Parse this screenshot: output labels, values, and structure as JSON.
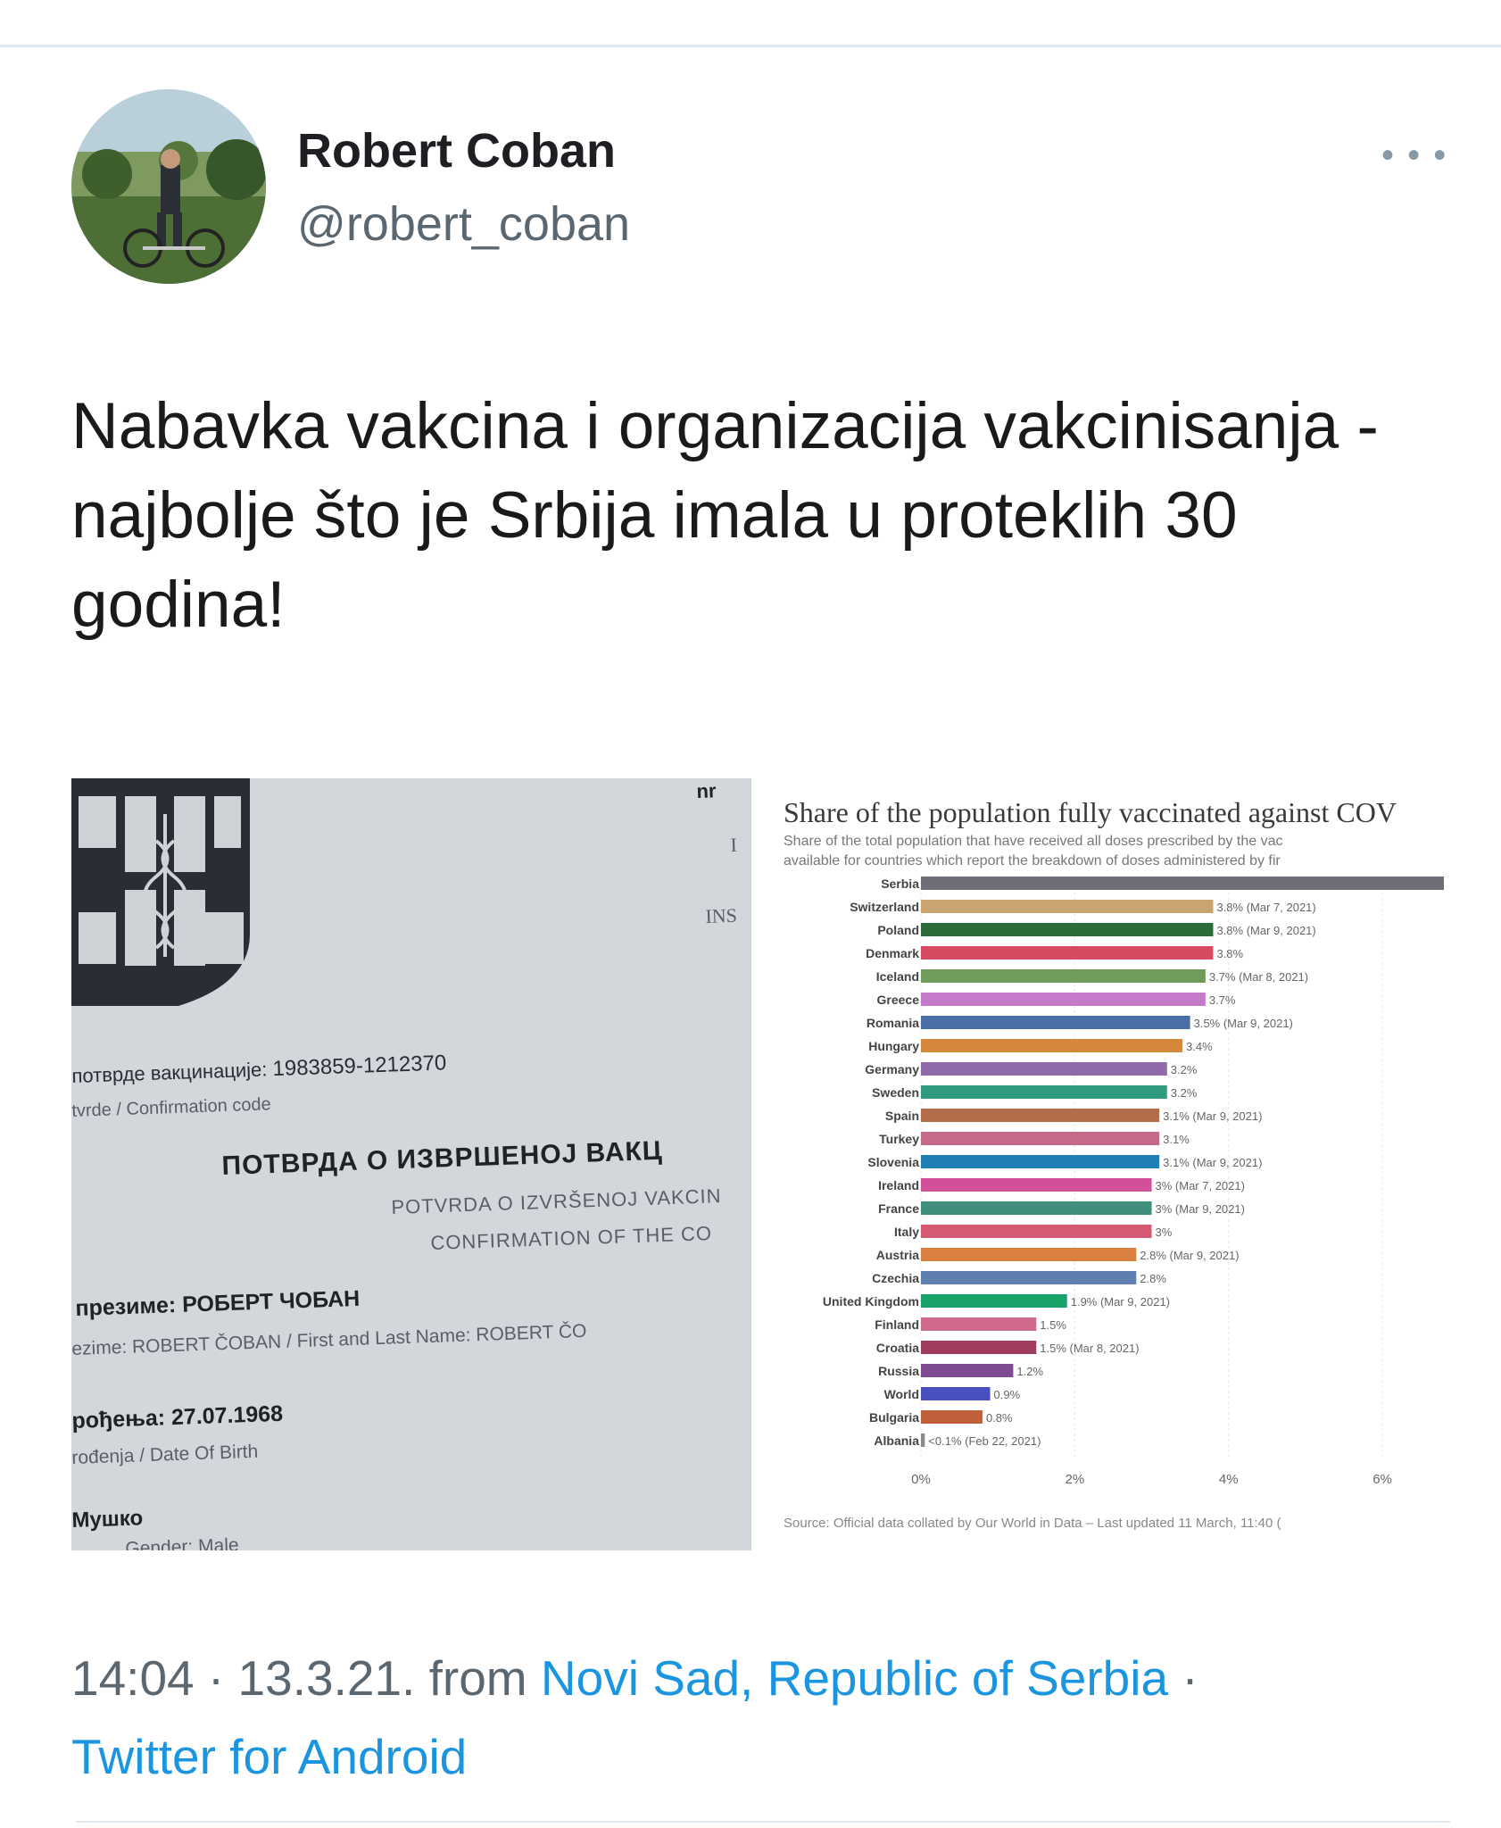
{
  "author": {
    "name": "Robert Coban",
    "handle": "@robert_coban"
  },
  "more_label": "• • •",
  "tweet_text": "Nabavka vakcina i organizacija vakcinisanja - najbolje što je Srbija imala u proteklih 30 godina!",
  "certificate": {
    "header_fragments": [
      "nr",
      "I",
      "INS"
    ],
    "code_label": "потврде вакцинације:",
    "code_value": "1983859-1212370",
    "code_label_latin": "tvrde / Confirmation code",
    "heading_cyr": "ПОТВРДА О ИЗВРШЕНОЈ ВАКЦ",
    "heading_lat": "POTVRDA O IZVRŠENOJ VAKCIN",
    "heading_en": "CONFIRMATION OF THE CO",
    "name_label": "презиме:",
    "name_value": "РОБЕРТ ЧОБАН",
    "name_latin": "ezime: ROBERT ČOBAN / First and Last Name: ROBERT ČO",
    "dob_label": "рођења:",
    "dob_value": "27.07.1968",
    "dob_latin": "rođenja / Date Of Birth",
    "gender_value": "Мушко",
    "gender_latin": "Gender: Male"
  },
  "chart_data": {
    "type": "bar",
    "orientation": "horizontal",
    "title": "Share of the population fully vaccinated against COV",
    "subtitle_lines": [
      "Share of the total population that have received all doses prescribed by the vac",
      "available for countries which report the breakdown of doses administered by fir"
    ],
    "source": "Source: Official data collated by Our World in Data – Last updated 11 March, 11:40 (",
    "categories": [
      "Serbia",
      "Switzerland",
      "Poland",
      "Denmark",
      "Iceland",
      "Greece",
      "Romania",
      "Hungary",
      "Germany",
      "Sweden",
      "Spain",
      "Turkey",
      "Slovenia",
      "Ireland",
      "France",
      "Italy",
      "Austria",
      "Czechia",
      "United Kingdom",
      "Finland",
      "Croatia",
      "Russia",
      "World",
      "Bulgaria",
      "Albania"
    ],
    "values": [
      6.8,
      3.8,
      3.8,
      3.8,
      3.7,
      3.7,
      3.5,
      3.4,
      3.2,
      3.2,
      3.1,
      3.1,
      3.1,
      3.0,
      3.0,
      3.0,
      2.8,
      2.8,
      1.9,
      1.5,
      1.5,
      1.2,
      0.9,
      0.8,
      0.05
    ],
    "value_labels": [
      "",
      "3.8% (Mar 7, 2021)",
      "3.8% (Mar 9, 2021)",
      "3.8%",
      "3.7% (Mar 8, 2021)",
      "3.7%",
      "3.5% (Mar 9, 2021)",
      "3.4%",
      "3.2%",
      "3.2%",
      "3.1% (Mar 9, 2021)",
      "3.1%",
      "3.1% (Mar 9, 2021)",
      "3% (Mar 7, 2021)",
      "3% (Mar 9, 2021)",
      "3%",
      "2.8% (Mar 9, 2021)",
      "2.8%",
      "1.9% (Mar 9, 2021)",
      "1.5%",
      "1.5% (Mar 8, 2021)",
      "1.2%",
      "0.9%",
      "0.8%",
      "<0.1% (Feb 22, 2021)"
    ],
    "colors": [
      "#6e6e78",
      "#c9a370",
      "#2e6b3a",
      "#d64b62",
      "#6f9c5a",
      "#c57ac9",
      "#4a6fa5",
      "#d6883a",
      "#8f6aa8",
      "#2f9b7f",
      "#b36d4a",
      "#c66a8c",
      "#1f7fb5",
      "#d24f9a",
      "#3f8f7c",
      "#d45a74",
      "#d98040",
      "#5f7fb0",
      "#19a36a",
      "#d06a8a",
      "#9e3e5c",
      "#7f4c91",
      "#4a4fc0",
      "#c0603a",
      "#8a8a8a"
    ],
    "x_ticks": [
      "0%",
      "2%",
      "4%",
      "6%"
    ],
    "xlim": [
      0,
      6.8
    ]
  },
  "footer": {
    "time": "14:04",
    "separator": " · ",
    "date": "13.3.21.",
    "from_word": " from ",
    "location": "Novi Sad, Republic of Serbia",
    "trailing_sep": " ·",
    "client": "Twitter for Android"
  }
}
